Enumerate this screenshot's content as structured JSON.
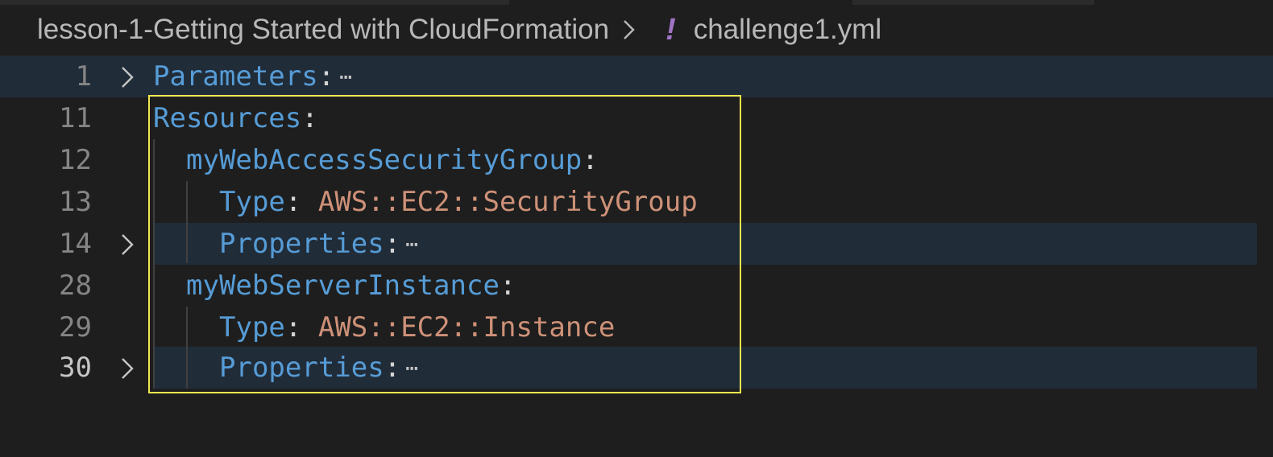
{
  "breadcrumb": {
    "folder": "lesson-1-Getting Started with CloudFormation",
    "file_icon": "!",
    "file": "challenge1.yml"
  },
  "editor": {
    "lines": [
      {
        "number": "1",
        "key": "Parameters",
        "colon": ":",
        "folded": true
      },
      {
        "number": "11",
        "key": "Resources",
        "colon": ":"
      },
      {
        "number": "12",
        "key": "myWebAccessSecurityGroup",
        "colon": ":"
      },
      {
        "number": "13",
        "key": "Type",
        "colon": ":",
        "value": "AWS::EC2::SecurityGroup"
      },
      {
        "number": "14",
        "key": "Properties",
        "colon": ":",
        "folded": true
      },
      {
        "number": "28",
        "key": "myWebServerInstance",
        "colon": ":"
      },
      {
        "number": "29",
        "key": "Type",
        "colon": ":",
        "value": "AWS::EC2::Instance"
      },
      {
        "number": "30",
        "key": "Properties",
        "colon": ":",
        "folded": true
      }
    ],
    "fold_ellipsis": "⋯"
  },
  "colors": {
    "background": "#1e1e1e",
    "key": "#569cd6",
    "value": "#ce9178",
    "folded_line_highlight": "#212c39",
    "selection_box": "#f2e94e",
    "yaml_icon": "#a074c4"
  }
}
